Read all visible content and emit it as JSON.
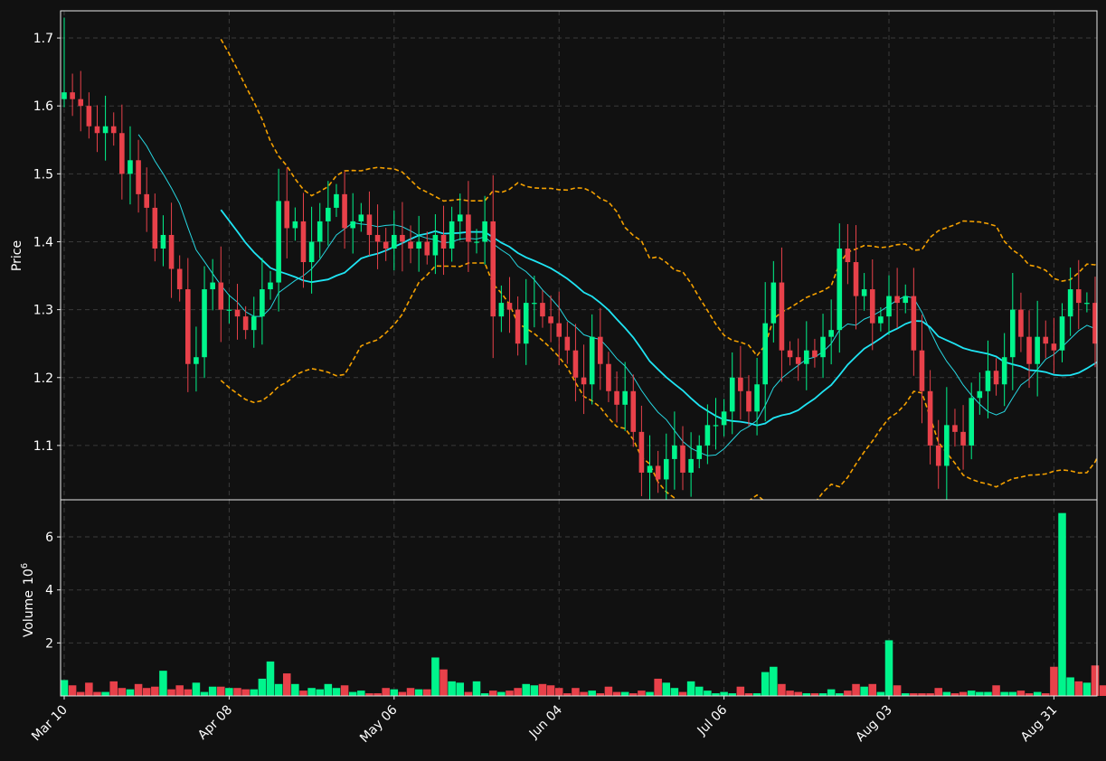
{
  "chart_data": [
    {
      "panel": "price",
      "type": "candlestick",
      "ylabel": "Price",
      "ylim": [
        1.02,
        1.74
      ],
      "yticks": [
        "1.1",
        "1.2",
        "1.3",
        "1.4",
        "1.5",
        "1.6",
        "1.7"
      ],
      "grid": true,
      "overlays": [
        {
          "name": "",
          "style": "thin cyan line, short moving average"
        },
        {
          "name": "",
          "style": "thick cyan line, long moving average"
        },
        {
          "name": "",
          "style": "dashed orange bands above and below"
        }
      ],
      "days": 128,
      "close": [
        1.62,
        1.61,
        1.6,
        1.57,
        1.56,
        1.57,
        1.56,
        1.5,
        1.52,
        1.47,
        1.45,
        1.39,
        1.41,
        1.36,
        1.33,
        1.22,
        1.23,
        1.33,
        1.34,
        1.3,
        1.3,
        1.29,
        1.27,
        1.29,
        1.33,
        1.34,
        1.46,
        1.42,
        1.43,
        1.37,
        1.4,
        1.43,
        1.45,
        1.47,
        1.42,
        1.43,
        1.44,
        1.41,
        1.4,
        1.39,
        1.41,
        1.4,
        1.39,
        1.4,
        1.38,
        1.41,
        1.39,
        1.43,
        1.44,
        1.4,
        1.4,
        1.43,
        1.29,
        1.31,
        1.3,
        1.25,
        1.31,
        1.31,
        1.29,
        1.28,
        1.26,
        1.24,
        1.2,
        1.19,
        1.26,
        1.22,
        1.18,
        1.16,
        1.18,
        1.12,
        1.06,
        1.07,
        1.05,
        1.08,
        1.1,
        1.06,
        1.08,
        1.1,
        1.13,
        1.13,
        1.15,
        1.2,
        1.18,
        1.15,
        1.19,
        1.28,
        1.34,
        1.24,
        1.23,
        1.22,
        1.24,
        1.23,
        1.26,
        1.27,
        1.39,
        1.37,
        1.32,
        1.33,
        1.28,
        1.29,
        1.32,
        1.31,
        1.32,
        1.24,
        1.18,
        1.1,
        1.07,
        1.13,
        1.12,
        1.1,
        1.17,
        1.18,
        1.21,
        1.19,
        1.23,
        1.3,
        1.26,
        1.22,
        1.26,
        1.25,
        1.24,
        1.29,
        1.33,
        1.31,
        1.31,
        1.25,
        1.22,
        1.26
      ]
    },
    {
      "panel": "volume",
      "type": "bar",
      "ylabel": "Volume",
      "ylabel_exp": "10",
      "ylabel_exp_power": "6",
      "ylim": [
        0,
        7.4
      ],
      "yticks": [
        "2",
        "4",
        "6"
      ],
      "grid": true,
      "values": [
        0.6,
        0.4,
        0.15,
        0.5,
        0.15,
        0.15,
        0.55,
        0.3,
        0.25,
        0.45,
        0.3,
        0.35,
        0.95,
        0.25,
        0.4,
        0.25,
        0.5,
        0.15,
        0.35,
        0.35,
        0.3,
        0.3,
        0.25,
        0.25,
        0.65,
        1.3,
        0.45,
        0.85,
        0.45,
        0.2,
        0.3,
        0.25,
        0.45,
        0.3,
        0.4,
        0.15,
        0.2,
        0.1,
        0.1,
        0.3,
        0.25,
        0.15,
        0.3,
        0.25,
        0.25,
        1.45,
        1.0,
        0.55,
        0.5,
        0.15,
        0.55,
        0.1,
        0.2,
        0.15,
        0.2,
        0.3,
        0.45,
        0.4,
        0.45,
        0.4,
        0.3,
        0.1,
        0.3,
        0.15,
        0.2,
        0.1,
        0.35,
        0.15,
        0.15,
        0.1,
        0.2,
        0.15,
        0.65,
        0.5,
        0.3,
        0.15,
        0.55,
        0.35,
        0.2,
        0.1,
        0.15,
        0.1,
        0.35,
        0.1,
        0.1,
        0.9,
        1.1,
        0.45,
        0.2,
        0.15,
        0.1,
        0.1,
        0.1,
        0.25,
        0.1,
        0.2,
        0.45,
        0.35,
        0.45,
        0.15,
        2.1,
        0.4,
        0.1,
        0.1,
        0.1,
        0.1,
        0.3,
        0.15,
        0.1,
        0.15,
        0.2,
        0.15,
        0.15,
        0.4,
        0.15,
        0.15,
        0.2,
        0.1,
        0.15,
        0.1,
        1.1,
        6.9,
        0.7,
        0.55,
        0.5,
        1.15,
        0.4
      ]
    }
  ],
  "x_axis": {
    "tick_labels": [
      "Mar 10",
      "Apr 08",
      "May 06",
      "Jun 04",
      "Jul 06",
      "Aug 03",
      "Aug 31"
    ],
    "tick_index": [
      0,
      20,
      40,
      60,
      80,
      100,
      120
    ]
  },
  "colors": {
    "background": "#111111",
    "up": "#00f58c",
    "down": "#e8414a",
    "ma_short": "#27d6e0",
    "ma_long": "#1fe4f3",
    "bands": "#f5a100",
    "grid": "#3a3a3a",
    "spine": "#e6e6e6",
    "text": "#ffffff"
  }
}
